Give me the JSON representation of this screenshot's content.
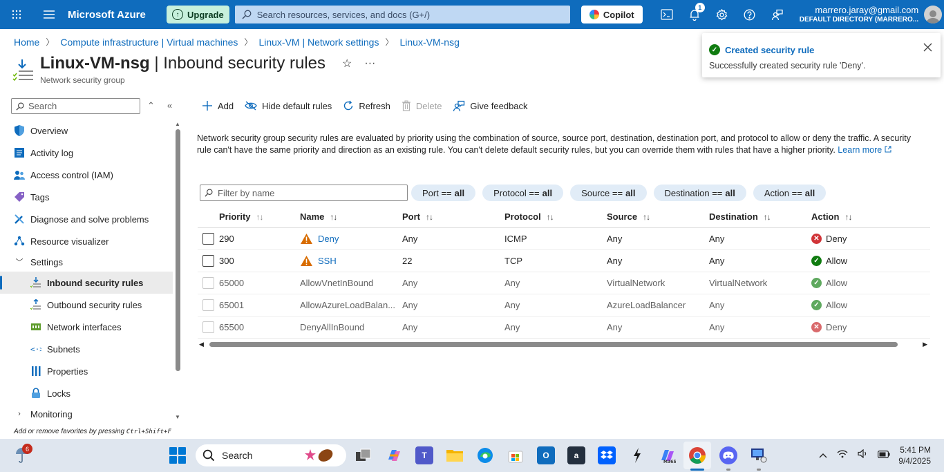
{
  "topbar": {
    "brand": "Microsoft Azure",
    "upgrade_label": "Upgrade",
    "search_placeholder": "Search resources, services, and docs (G+/)",
    "copilot_label": "Copilot",
    "notifications_count": "1",
    "user_email": "marrero.jaray@gmail.com",
    "user_directory": "DEFAULT DIRECTORY (MARRERO...",
    "accent": "#0f6cbd"
  },
  "breadcrumb": [
    "Home",
    "Compute infrastructure | Virtual machines",
    "Linux-VM | Network settings",
    "Linux-VM-nsg"
  ],
  "page": {
    "resource_name": "Linux-VM-nsg",
    "title_separator": " | ",
    "blade_title": "Inbound security rules",
    "subtitle": "Network security group"
  },
  "sidebar": {
    "search_placeholder": "Search",
    "items": [
      {
        "label": "Overview",
        "icon": "shield-icon"
      },
      {
        "label": "Activity log",
        "icon": "activity-log-icon"
      },
      {
        "label": "Access control (IAM)",
        "icon": "people-icon"
      },
      {
        "label": "Tags",
        "icon": "tag-icon"
      },
      {
        "label": "Diagnose and solve problems",
        "icon": "wrench-icon"
      },
      {
        "label": "Resource visualizer",
        "icon": "visualizer-icon"
      }
    ],
    "settings_group": "Settings",
    "settings_items": [
      {
        "label": "Inbound security rules",
        "icon": "inbound-icon",
        "active": true
      },
      {
        "label": "Outbound security rules",
        "icon": "outbound-icon"
      },
      {
        "label": "Network interfaces",
        "icon": "nic-icon"
      },
      {
        "label": "Subnets",
        "icon": "subnet-icon"
      },
      {
        "label": "Properties",
        "icon": "properties-icon"
      },
      {
        "label": "Locks",
        "icon": "lock-icon"
      }
    ],
    "monitoring_group": "Monitoring",
    "favorites_hint": "Add or remove favorites by pressing ",
    "favorites_keys": "Ctrl+Shift+F"
  },
  "toolbar": {
    "add": "Add",
    "hide_default": "Hide default rules",
    "refresh": "Refresh",
    "delete": "Delete",
    "feedback": "Give feedback"
  },
  "description": {
    "text": "Network security group security rules are evaluated by priority using the combination of source, source port, destination, destination port, and protocol to allow or deny the traffic. A security rule can't have the same priority and direction as an existing rule. You can't delete default security rules, but you can override them with rules that have a higher priority.",
    "learn_more": "Learn more"
  },
  "filters": {
    "name_placeholder": "Filter by name",
    "pills": [
      {
        "key": "Port ==",
        "value": "all"
      },
      {
        "key": "Protocol ==",
        "value": "all"
      },
      {
        "key": "Source ==",
        "value": "all"
      },
      {
        "key": "Destination ==",
        "value": "all"
      },
      {
        "key": "Action ==",
        "value": "all"
      }
    ]
  },
  "table": {
    "headers": [
      "Priority",
      "Name",
      "Port",
      "Protocol",
      "Source",
      "Destination",
      "Action"
    ],
    "rows": [
      {
        "priority": "290",
        "name": "Deny",
        "port": "Any",
        "protocol": "ICMP",
        "source": "Any",
        "destination": "Any",
        "action": "Deny",
        "custom": true
      },
      {
        "priority": "300",
        "name": "SSH",
        "port": "22",
        "protocol": "TCP",
        "source": "Any",
        "destination": "Any",
        "action": "Allow",
        "custom": true
      },
      {
        "priority": "65000",
        "name": "AllowVnetInBound",
        "port": "Any",
        "protocol": "Any",
        "source": "VirtualNetwork",
        "destination": "VirtualNetwork",
        "action": "Allow",
        "custom": false
      },
      {
        "priority": "65001",
        "name": "AllowAzureLoadBalan...",
        "port": "Any",
        "protocol": "Any",
        "source": "AzureLoadBalancer",
        "destination": "Any",
        "action": "Allow",
        "custom": false
      },
      {
        "priority": "65500",
        "name": "DenyAllInBound",
        "port": "Any",
        "protocol": "Any",
        "source": "Any",
        "destination": "Any",
        "action": "Deny",
        "custom": false
      }
    ]
  },
  "toast": {
    "title": "Created security rule",
    "message": "Successfully created security rule 'Deny'."
  },
  "taskbar": {
    "weather_badge": "6",
    "search_placeholder": "Search",
    "time": "5:41 PM",
    "date": "9/4/2025"
  }
}
